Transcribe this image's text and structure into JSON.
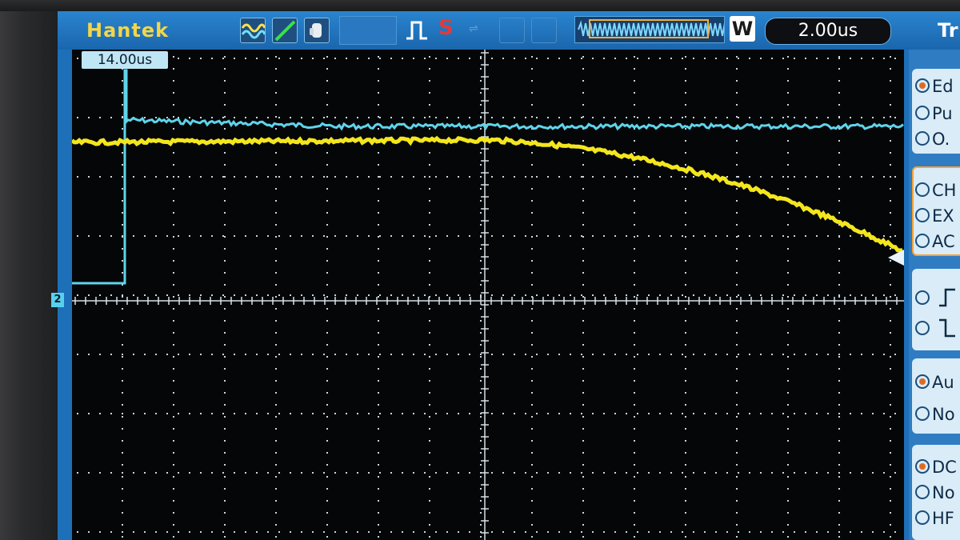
{
  "header": {
    "brand": "Hantek",
    "timebase": "2.00us",
    "memory_mode_badge": "W",
    "side_menu_title": "Tr",
    "status_icon_s": "S"
  },
  "plot": {
    "trigger_position_label": "14.00us",
    "channel_marker": "2",
    "trace_colors": {
      "ch1": "#f3e61e",
      "ch2": "#5fd4ea"
    }
  },
  "side_menu": {
    "type_options": [
      {
        "label": "Ed",
        "selected": true
      },
      {
        "label": "Pu",
        "selected": false
      },
      {
        "label": "O.",
        "selected": false
      }
    ],
    "source_options": [
      {
        "label": "CH",
        "selected": false
      },
      {
        "label": "EX",
        "selected": false
      },
      {
        "label": "AC",
        "selected": false
      }
    ],
    "slope_options": [
      {
        "label": "∫",
        "selected": false
      },
      {
        "label": "∖",
        "selected": false
      }
    ],
    "mode_options": [
      {
        "label": "Au",
        "selected": true
      },
      {
        "label": "No",
        "selected": false
      }
    ],
    "coupling_options": [
      {
        "label": "DC",
        "selected": true
      },
      {
        "label": "No",
        "selected": false
      },
      {
        "label": "HF",
        "selected": false
      }
    ]
  },
  "icons": [
    "waveform-icon",
    "cursor-line-icon",
    "hand-icon",
    "pulse-icon",
    "run-status-icon",
    "memory-window-icon"
  ],
  "colors": {
    "screen_blue": "#1d6fb8",
    "brand_yellow": "#f2d64a",
    "trigger_orange": "#f6b338"
  }
}
